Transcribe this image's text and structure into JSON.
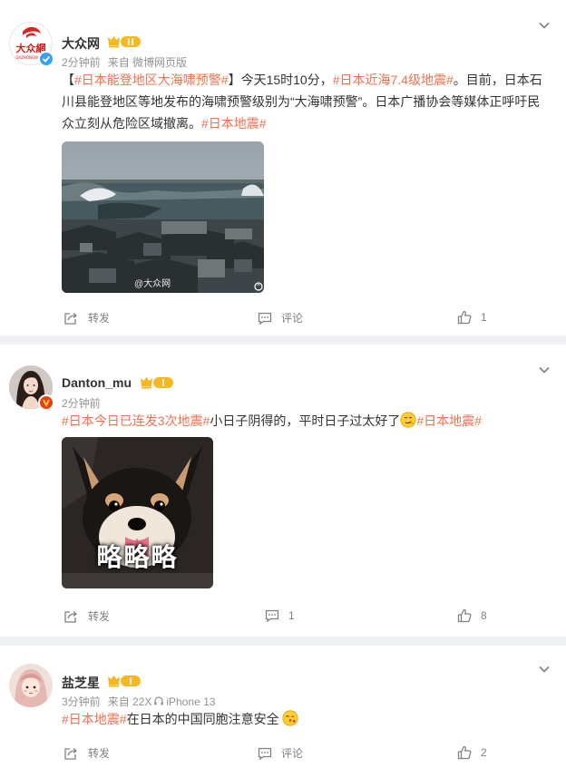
{
  "posts": [
    {
      "author": "大众网",
      "avatar_text": "大众網",
      "avatar_subtext": "DAZHONGWANG",
      "verified": true,
      "level": "II",
      "time": "2分钟前",
      "source": "来自 微博网页版",
      "text_parts": [
        "【",
        "#日本能登地区大海啸预警#",
        "】今天15时10分，",
        "#日本近海7.4级地震#",
        "。目前，日本石川县能登地区等地发布的海啸预警级别为“大海啸预警”。日本广播协会等媒体正呼吁民众立刻从危险区域撤离。",
        "#日本地震#"
      ],
      "image_watermark": "@大众网",
      "repost_label": "转发",
      "comment_label": "评论",
      "like_count": "1"
    },
    {
      "author": "Danton_mu",
      "level": "I",
      "time": "2分钟前",
      "text_parts": [
        "#日本今日已连发3次地震#",
        "小日子阴得的，平时日子过太好了",
        "#日本地震#"
      ],
      "emoji": "smirk-face",
      "image_caption": "略略略",
      "repost_label": "转发",
      "comment_count": "1",
      "like_count": "8"
    },
    {
      "author": "盐芝星",
      "level": "I",
      "time": "3分钟前",
      "source": "来自 22X",
      "device": "iPhone 13",
      "text_parts": [
        "#日本地震#",
        "在日本的中国同胞注意安全"
      ],
      "emoji": "kiss-face",
      "repost_label": "转发",
      "comment_label": "评论",
      "like_count": "2"
    }
  ],
  "colors": {
    "hashtag": "#eb7350",
    "level_badge": "#f5b821",
    "verified": "#3aa0f5"
  }
}
